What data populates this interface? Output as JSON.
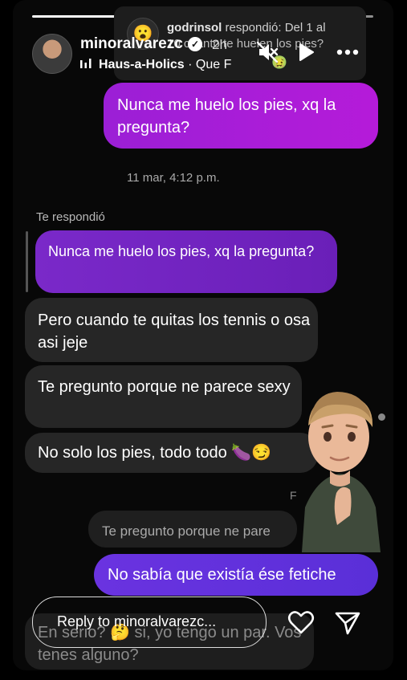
{
  "story_header": {
    "username": "minoralvarezc",
    "time_ago": "2h",
    "music_artist": "Haus-a-Holics",
    "music_sep": " · ",
    "music_song": "Que F"
  },
  "story_reply_preview": {
    "title_user": "godrinsol",
    "title_rest": " respondió: Del 1 al",
    "body": "10 cuanto te huelen los pies?",
    "avatar_emoji": "😮",
    "trailing_emoji": "🤢"
  },
  "messages": {
    "sent_1": "Nunca me huelo los pies, xq la pregunta?",
    "timestamp": "11 mar, 4:12 p.m.",
    "replied_label": "Te respondió",
    "quoted": "Nunca me huelo los pies, xq la pregunta?",
    "recv_1": "Pero cuando te quitas los tennis o  osa asi jeje",
    "recv_2": "Te pregunto porque ne parece sexy",
    "recv_3": "No solo los pies, todo todo 🍆😏",
    "quote_2": "Te pregunto porque ne pare",
    "sent_2": "No sabía que existía ése fetiche",
    "faded": "En serio? 🤔 si, yo tengo un par. Vos tenes alguno?"
  },
  "side_letter": "F",
  "reply_bar": {
    "placeholder": "Reply to minoralvarezc..."
  },
  "icons": [
    "verified-icon",
    "music-icon",
    "mute-icon",
    "play-icon",
    "more-icon",
    "heart-icon",
    "send-icon"
  ],
  "colors": {
    "sent_bubble": "#b51bd9",
    "quoted_bubble": "#7a29c9",
    "sent_bubble_2": "#6a33e0",
    "received_bubble": "#262626"
  }
}
